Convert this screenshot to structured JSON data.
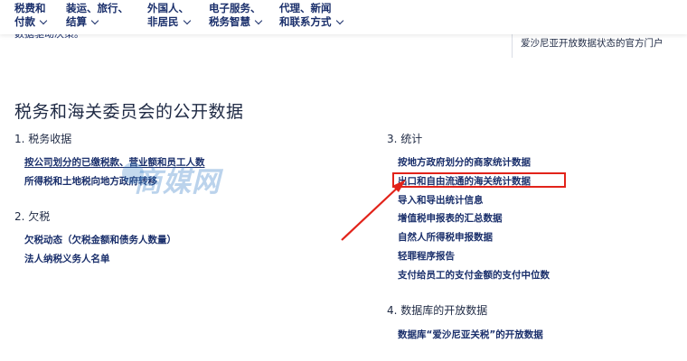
{
  "nav": {
    "items": [
      {
        "line1": "税费和",
        "line2": "付款"
      },
      {
        "line1": "装运、旅行、",
        "line2": "结算"
      },
      {
        "line1": "外国人、",
        "line2": "非居民"
      },
      {
        "line1": "电子服务、",
        "line2": "税务智慧"
      },
      {
        "line1": "代理、新闻",
        "line2": "和联系方式"
      }
    ]
  },
  "under_nav": {
    "left_text": "数据驱动决策。",
    "right_text": "爱沙尼亚开放数据状态的官方门户"
  },
  "page_title": "税务和海关委员会的公开数据",
  "sections": {
    "tax_receipts": {
      "title": "1. 税务收据",
      "links": [
        "按公司划分的已缴税款、营业额和员工人数",
        "所得税和土地税向地方政府转移"
      ]
    },
    "arrears": {
      "title": "2. 欠税",
      "links": [
        "欠税动态（欠税金额和债务人数量）",
        "法人纳税义务人名单"
      ]
    },
    "statistics": {
      "title": "3. 统计",
      "links": [
        "按地方政府划分的商家统计数据",
        "出口和自由流通的海关统计数据",
        "导入和导出统计信息",
        "增值税申报表的汇总数据",
        "自然人所得税申报数据",
        "轻罪程序报告",
        "支付给员工的支付金额的支付中位数"
      ]
    },
    "database": {
      "title": "4. 数据库的开放数据",
      "links": [
        "数据库“爱沙尼亚关税”的开放数据"
      ]
    }
  },
  "watermark_text": "商媒网",
  "colors": {
    "link": "#1a2f6b",
    "highlight": "#e2231a",
    "watermark": "#3c82c8"
  }
}
